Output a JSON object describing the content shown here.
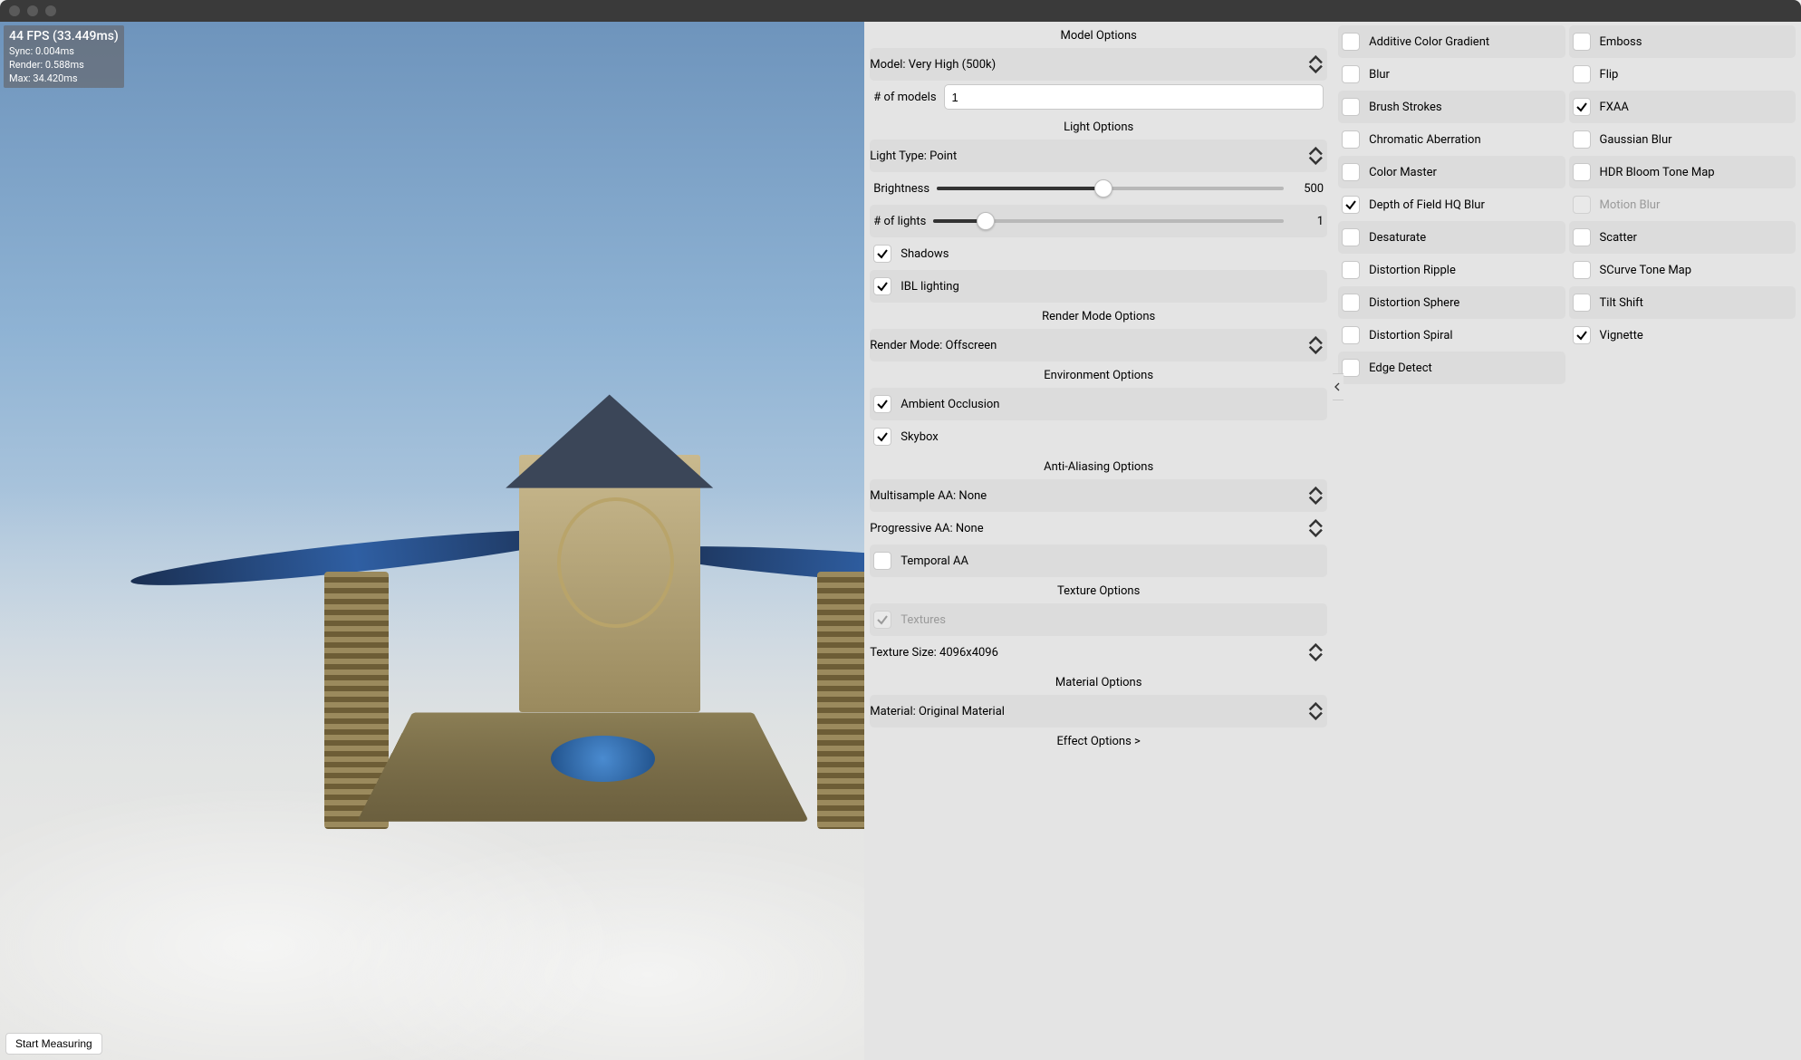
{
  "fps": {
    "headline": "44 FPS (33.449ms)",
    "sync": "Sync: 0.004ms",
    "render": "Render: 0.588ms",
    "max": "Max: 34.420ms"
  },
  "start_button": "Start Measuring",
  "middle": {
    "model": {
      "header": "Model Options",
      "model_dd": "Model: Very High (500k)",
      "num_models_label": "# of models",
      "num_models_value": "1"
    },
    "light": {
      "header": "Light Options",
      "type_dd": "Light Type: Point",
      "brightness_label": "Brightness",
      "brightness_value": "500",
      "brightness_pct": 48,
      "num_lights_label": "# of lights",
      "num_lights_value": "1",
      "num_lights_pct": 15,
      "shadows": "Shadows",
      "ibl": "IBL lighting"
    },
    "render": {
      "header": "Render Mode Options",
      "mode_dd": "Render Mode: Offscreen"
    },
    "env": {
      "header": "Environment Options",
      "ao": "Ambient Occlusion",
      "skybox": "Skybox"
    },
    "aa": {
      "header": "Anti-Aliasing Options",
      "msaa_dd": "Multisample AA: None",
      "prog_dd": "Progressive AA: None",
      "temporal": "Temporal AA"
    },
    "tex": {
      "header": "Texture Options",
      "textures": "Textures",
      "size_dd": "Texture Size: 4096x4096"
    },
    "mat": {
      "header": "Material Options",
      "mat_dd": "Material: Original Material"
    },
    "effect_link": "Effect Options >"
  },
  "effects": [
    {
      "label": "Additive Color Gradient",
      "checked": false
    },
    {
      "label": "Blur",
      "checked": false
    },
    {
      "label": "Brush Strokes",
      "checked": false
    },
    {
      "label": "Chromatic Aberration",
      "checked": false
    },
    {
      "label": "Color Master",
      "checked": false
    },
    {
      "label": "Depth of Field HQ Blur",
      "checked": true
    },
    {
      "label": "Desaturate",
      "checked": false
    },
    {
      "label": "Distortion Ripple",
      "checked": false
    },
    {
      "label": "Distortion Sphere",
      "checked": false
    },
    {
      "label": "Distortion Spiral",
      "checked": false
    },
    {
      "label": "Edge Detect",
      "checked": false
    }
  ],
  "effects2": [
    {
      "label": "Emboss",
      "checked": false
    },
    {
      "label": "Flip",
      "checked": false
    },
    {
      "label": "FXAA",
      "checked": true
    },
    {
      "label": "Gaussian Blur",
      "checked": false
    },
    {
      "label": "HDR Bloom Tone Map",
      "checked": false
    },
    {
      "label": "Motion Blur",
      "checked": false,
      "disabled": true
    },
    {
      "label": "Scatter",
      "checked": false
    },
    {
      "label": "SCurve Tone Map",
      "checked": false
    },
    {
      "label": "Tilt Shift",
      "checked": false
    },
    {
      "label": "Vignette",
      "checked": true
    }
  ]
}
